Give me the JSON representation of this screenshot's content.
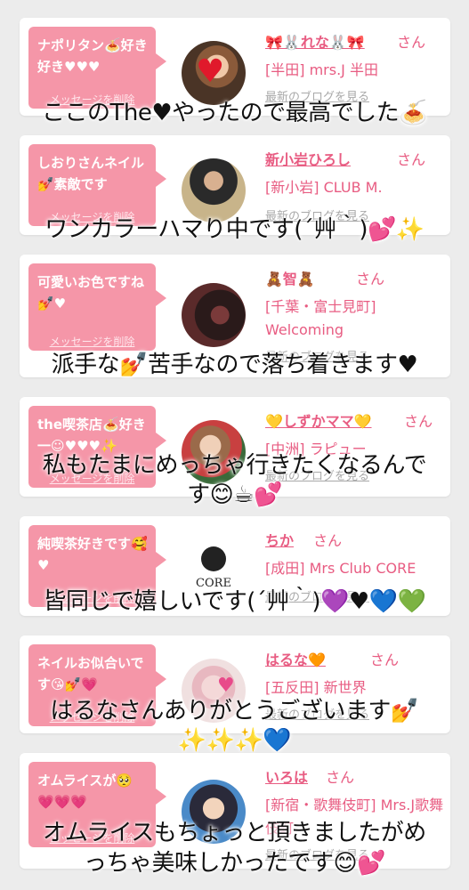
{
  "items": [
    {
      "bubble": "ナポリタン🍝好き好き♥♥♥",
      "username": "🎀🐰れな🐰🎀",
      "san": "さん",
      "shop": "[半田] mrs.J 半田",
      "blog": "最新のブログを見る",
      "delete": "メッセージを削除",
      "overlay": [
        "ここのThe♥やったので最高でした🍝"
      ]
    },
    {
      "bubble": "しおりさんネイル💅素敵です",
      "username": "新小岩ひろし",
      "san": "さん",
      "shop": "[新小岩] CLUB M.",
      "blog": "最新のブログを見る",
      "delete": "メッセージを削除",
      "overlay": [
        "ワンカラーハマり中です(´艸｀)💕✨"
      ]
    },
    {
      "bubble": "可愛いお色ですね💅♥",
      "username": "🧸智🧸",
      "san": "さん",
      "shop": "[千葉・富士見町] Welcoming",
      "blog": "最新のブログを見る",
      "delete": "メッセージを削除",
      "overlay": [
        "派手な💅苦手なので落ち着きます♥"
      ]
    },
    {
      "bubble": "the喫茶店🍝好き一☺♥♥♥✨",
      "username": "💛しずかママ💛",
      "san": "さん",
      "shop": "[中洲] ラピュー",
      "blog": "最新のブログを見る",
      "delete": "メッセージを削除",
      "overlay": [
        "私もたまにめっちゃ行きたくなるんで",
        "す😊☕💕"
      ]
    },
    {
      "bubble": "純喫茶好きです🥰♥",
      "username": "ちか",
      "san": "さん",
      "shop": "[成田] Mrs Club CORE",
      "blog": "最新のブログを見る",
      "delete": "メッセージを削除",
      "overlay": [
        "皆同じで嬉しいです(´艸｀)💜♥💙💚"
      ]
    },
    {
      "bubble": "ネイルお似合いです😘💅💗",
      "username": "はるな🧡",
      "san": "さん",
      "shop": "[五反田] 新世界",
      "blog": "最新のブログを見る",
      "delete": "メッセージを削除",
      "overlay": [
        "はるなさんありがとうございます💅",
        "✨✨✨💙"
      ]
    },
    {
      "bubble": "オムライスが🥺💗💗💗",
      "username": "いろは",
      "san": "さん",
      "shop": "[新宿・歌舞伎町] Mrs.J歌舞伎町",
      "blog": "最新のブログを見る",
      "delete": "メッセージを削除",
      "overlay": [
        "オムライスもちょっと頂きましたがめ",
        "っちゃ美味しかったです😊💕"
      ]
    }
  ],
  "logo_text": "CORE",
  "colors": {
    "bubble": "#f596a8",
    "accent": "#e85c82",
    "muted": "#a8a8a8",
    "card": "#ffffff",
    "background": "#ececec"
  }
}
